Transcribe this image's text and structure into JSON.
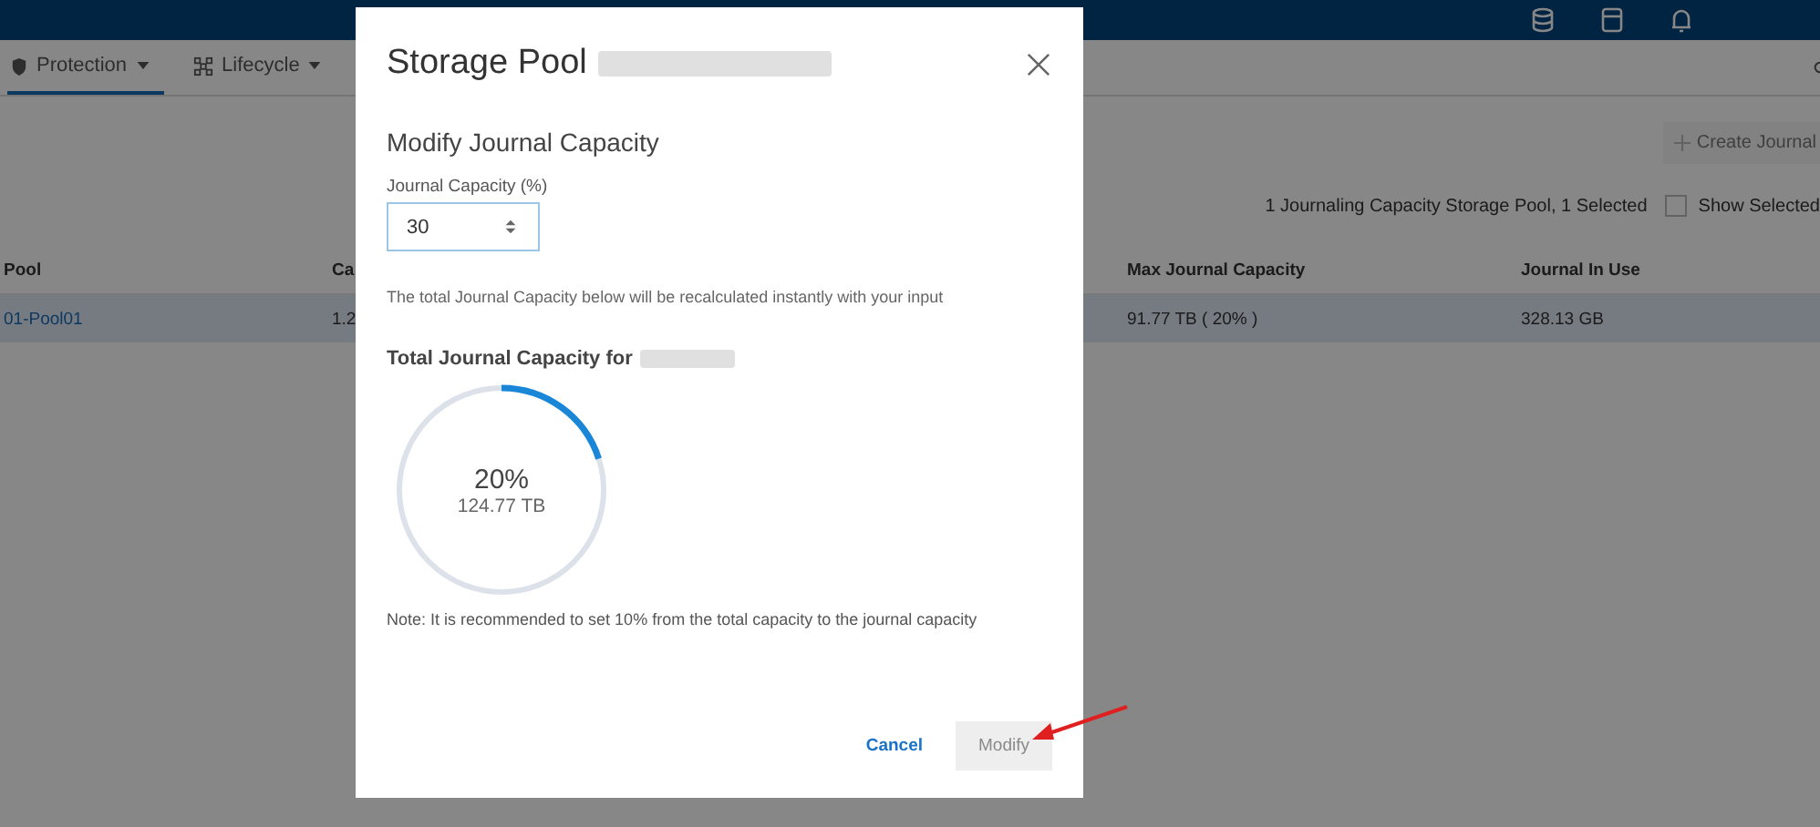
{
  "tabs": [
    {
      "label": "Protection",
      "selected": true
    },
    {
      "label": "Lifecycle",
      "selected": false
    }
  ],
  "toolbar": {
    "create_button": {
      "label": "Create Journal",
      "disabled": true
    },
    "summary": "1 Journaling Capacity Storage Pool, 1 Selected",
    "show_selected": {
      "label": "Show Selected",
      "checked": false
    }
  },
  "table": {
    "columns": [
      "Pool",
      "Ca",
      "Max Journal Capacity",
      "Journal In Use"
    ],
    "rows": [
      {
        "selected": true,
        "cells": [
          "01-Pool01",
          "1.2",
          "91.77 TB ( 20% )",
          "328.13 GB"
        ]
      }
    ]
  },
  "dialog": {
    "title": "Storage Pool",
    "section_title": "Modify Journal Capacity",
    "field": {
      "label": "Journal Capacity (%)",
      "value": "30"
    },
    "helper": "The total Journal Capacity below will be recalculated instantly with your input",
    "total_title": "Total Journal Capacity for",
    "gauge": {
      "level": 0.2,
      "percent": "20%",
      "amount": "124.77 TB"
    },
    "note": "Note: It is recommended to set 10% from the total capacity to the journal capacity",
    "buttons": [
      {
        "kind": "link",
        "label": "Cancel"
      },
      {
        "kind": "primary",
        "label": "Modify",
        "disabled": true
      }
    ]
  }
}
